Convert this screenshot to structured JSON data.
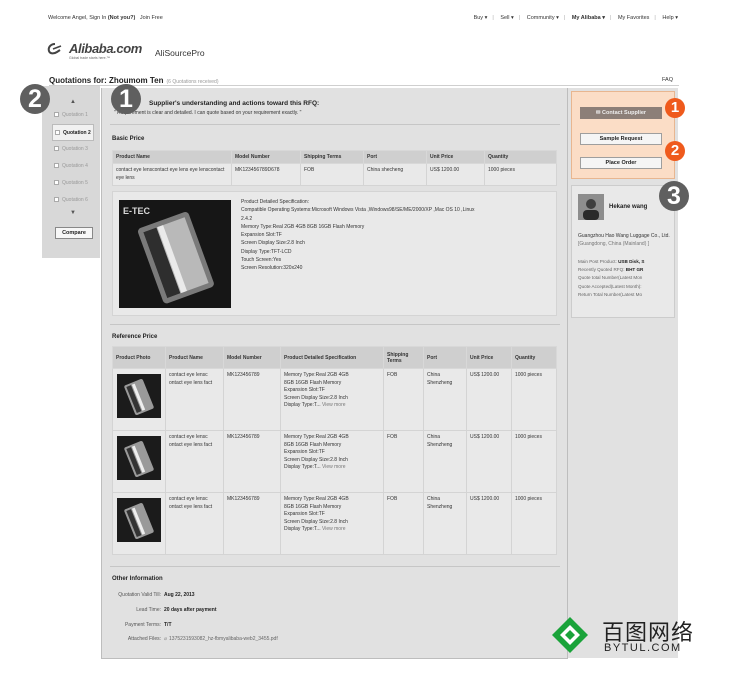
{
  "topbar": {
    "welcome": "Welcome Angel,",
    "sign_in": "Sign In",
    "not_you": "(Not you?)",
    "join": "Join Free",
    "menus": [
      "Buy ▾",
      "Sell ▾",
      "Community ▾",
      "My Alibaba ▾",
      "My Favorites",
      "Help ▾"
    ]
  },
  "logo": {
    "text": "Alibaba.com",
    "tagline": "Global trade starts here.™",
    "product": "AliSourcePro"
  },
  "header": {
    "title": "Quotations for: Zhoumom Ten",
    "count": "(6 Quotations received)",
    "faq": "FAQ"
  },
  "quotation_nav": {
    "up": "▲",
    "down": "▼",
    "items": [
      "Quotation 1",
      "Quotation 2",
      "Quotation 3",
      "Quotation 4",
      "Quotation 5",
      "Quotation 6"
    ],
    "active_index": 1,
    "compare": "Compare"
  },
  "understanding": {
    "title": "Supplier's understanding and actions toward this RFQ:",
    "text": "\" Requirement is clear and detailed. I can quote based on your requirement exactly. \""
  },
  "basic_price": {
    "title": "Basic Price",
    "headers": [
      "Product Name",
      "Model Number",
      "Shipping Terms",
      "Port",
      "Unit Price",
      "Quantity"
    ],
    "row": [
      "contact eye lenscontact eye lens eye lenscontact eye lens",
      "MK123456789D678",
      "FOB",
      "China shecheng",
      "US$ 1200.00",
      "1000 pieces"
    ],
    "spec_title": "Product Detailed Specification:",
    "spec_lines": [
      "Compatible Operating Systems:Microsoft Windows Vista ,Windows98/SE/ME/2000/XP ,Mac OS 10 ,Linux",
      "2.4.2",
      "Memory Type:Real 2GB 4GB 8GB 16GB Flash Memory",
      "Expansion Slot:TF",
      "Screen Display Size:2.8 Inch",
      "Display Type:TFT-LCD",
      "Touch Screen:Yes",
      "Screen Resolution:320x240"
    ],
    "image_text": "E-TEC"
  },
  "reference_price": {
    "title": "Reference Price",
    "headers": [
      "Product Photo",
      "Product Name",
      "Model Number",
      "Product Detailed Specification",
      "Shipping Terms",
      "Port",
      "Unit Price",
      "Quantity"
    ],
    "rows": [
      {
        "name": "contact eye lensc ontact eye lens fact",
        "model": "MK123456789",
        "spec": [
          "Memory Type:Real 2GB 4GB",
          "8GB 16GB Flash Memory",
          "Expansion Slot:TF",
          "Screen Display Size:2.8 Inch",
          "Display Type:T..."
        ],
        "view_more": "View more",
        "terms": "FOB",
        "port": "China Shenzheng",
        "price": "US$ 1200.00",
        "qty": "1000 pieces"
      },
      {
        "name": "contact eye lensc ontact eye lens fact",
        "model": "MK123456789",
        "spec": [
          "Memory Type:Real 2GB 4GB",
          "8GB 16GB Flash Memory",
          "Expansion Slot:TF",
          "Screen Display Size:2.8 Inch",
          "Display Type:T..."
        ],
        "view_more": "View more",
        "terms": "FOB",
        "port": "China Shenzheng",
        "price": "US$ 1200.00",
        "qty": "1000 pieces"
      },
      {
        "name": "contact eye lensc ontact eye lens fact",
        "model": "MK123456789",
        "spec": [
          "Memory Type:Real 2GB 4GB",
          "8GB 16GB Flash Memory",
          "Expansion Slot:TF",
          "Screen Display Size:2.8 Inch",
          "Display Type:T..."
        ],
        "view_more": "View more",
        "terms": "FOB",
        "port": "China Shenzheng",
        "price": "US$ 1200.00",
        "qty": "1000 pieces"
      }
    ]
  },
  "other_info": {
    "title": "Other Information",
    "valid_label": "Quotation Valid Till:",
    "valid_value": "Aug 22, 2013",
    "lead_label": "Lead Time:",
    "lead_value": "20 days after payment",
    "payment_label": "Payment Terms:",
    "payment_value": "T/T",
    "files_label": "Attached Files:",
    "files_value": "1375231593082_hz-fbmyalibaba-web2_3455.pdf"
  },
  "actions": {
    "contact": "✉ Contact Supplier",
    "sample": "Sample Request",
    "order": "Place Order"
  },
  "supplier": {
    "name": "Hekane wang",
    "company": "Guangzhou Hao Wang Luggage Co., Ltd.",
    "location": "[Guangdong, China (Mainland) ]",
    "stats": [
      {
        "label": "Main Post Product:",
        "value": "USB Disk, S"
      },
      {
        "label": "Recently Quoted RFQ:",
        "value": "BHT GR"
      },
      {
        "label": "Quote total Number(Latest Mon",
        "value": ""
      },
      {
        "label": "Quote Accepted(Latest Month):",
        "value": ""
      },
      {
        "label": "Return Total Number(Latest Mo",
        "value": ""
      }
    ]
  },
  "badges": {
    "b1": "1",
    "b2": "2",
    "b3": "3",
    "o1": "1",
    "o2": "2"
  },
  "watermark": {
    "cn": "百图网络",
    "en": "BYTUL.COM"
  },
  "colors": {
    "accent": "#ef5a1c",
    "action_bg": "#fbddc6",
    "marker": "#5f5f5f",
    "watermark_green": "#1aa33a"
  }
}
